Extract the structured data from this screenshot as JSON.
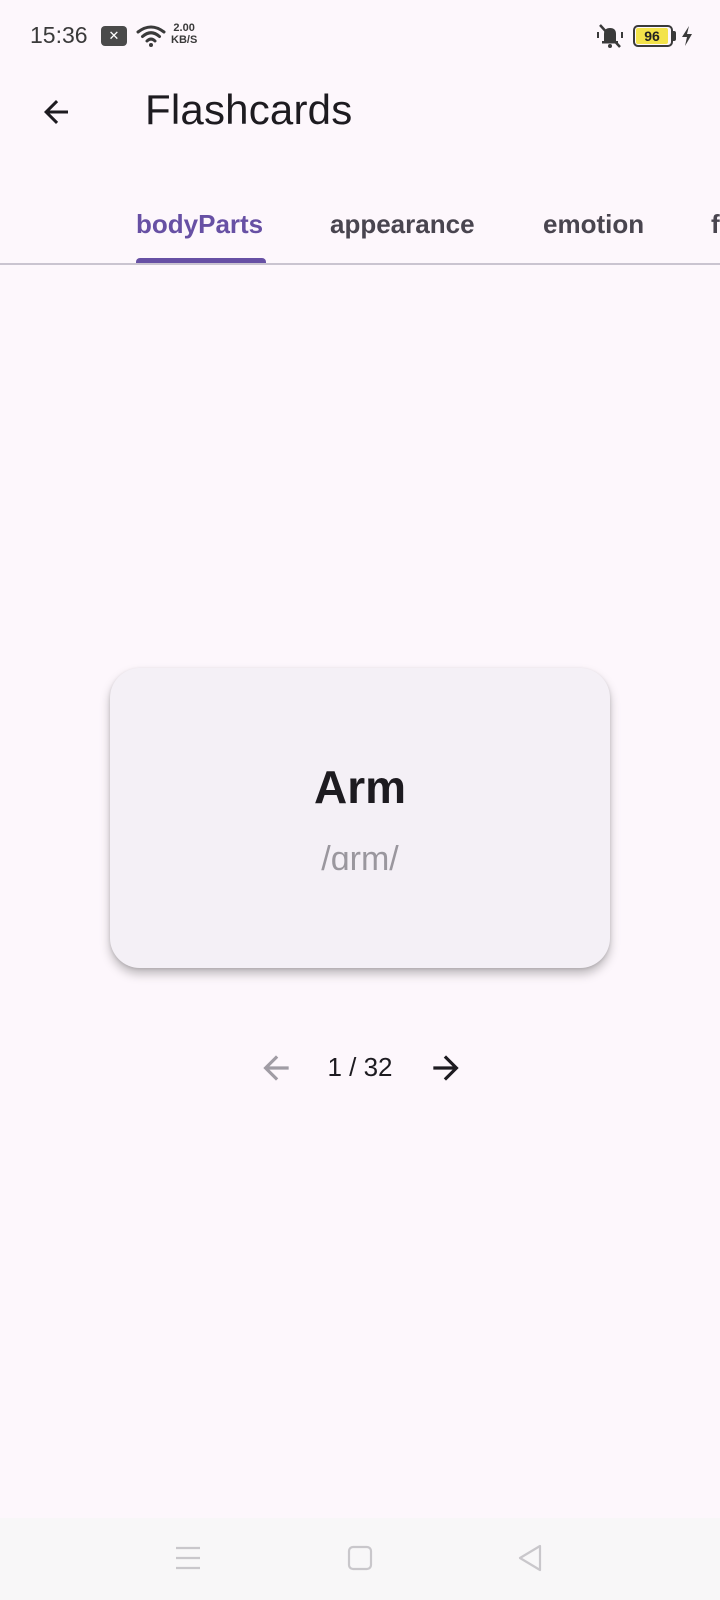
{
  "status_bar": {
    "time": "15:36",
    "notification_icon": "close-badge-icon",
    "wifi_icon": "wifi-icon",
    "net_speed_value": "2.00",
    "net_speed_unit": "KB/S",
    "mute_icon": "vibrate-off-icon",
    "battery_level": "96",
    "charging_icon": "bolt-icon"
  },
  "app_bar": {
    "back_icon": "arrow-back-icon",
    "title": "Flashcards"
  },
  "tabs": [
    {
      "label": "bodyParts",
      "active": true
    },
    {
      "label": "appearance",
      "active": false
    },
    {
      "label": "emotion",
      "active": false
    },
    {
      "label": "f",
      "active": false
    }
  ],
  "card": {
    "word": "Arm",
    "phonetic": "/ɑrm/"
  },
  "pager": {
    "prev_icon": "arrow-back-icon",
    "indicator": "1 / 32",
    "next_icon": "arrow-forward-icon"
  },
  "nav_bar": {
    "menu_icon": "menu-icon",
    "home_icon": "square-home-icon",
    "back_icon": "triangle-back-icon"
  },
  "colors": {
    "background": "#fdf7fc",
    "accent": "#6750a4",
    "card": "#f4f0f6",
    "battery": "#f3e34a"
  }
}
